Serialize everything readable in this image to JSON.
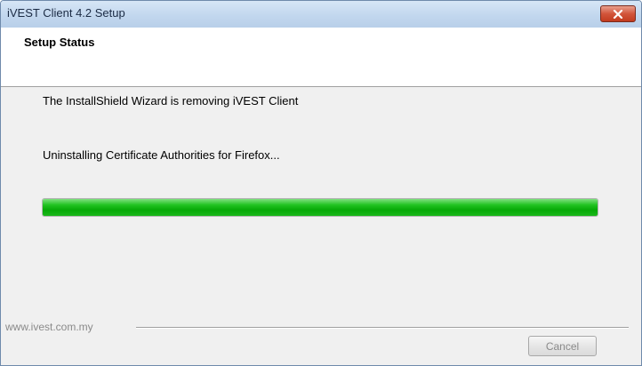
{
  "window": {
    "title": "iVEST Client 4.2 Setup",
    "close_icon": "close-icon"
  },
  "header": {
    "title": "Setup Status"
  },
  "main": {
    "status_message": "The InstallShield Wizard is removing iVEST Client",
    "action_message": "Uninstalling Certificate Authorities for Firefox...",
    "progress": 1.0
  },
  "footer": {
    "brand": "www.ivest.com.my",
    "cancel_label": "Cancel",
    "cancel_enabled": false
  },
  "colors": {
    "progress_fill": "#1ab71a",
    "close_button": "#d2553b"
  }
}
